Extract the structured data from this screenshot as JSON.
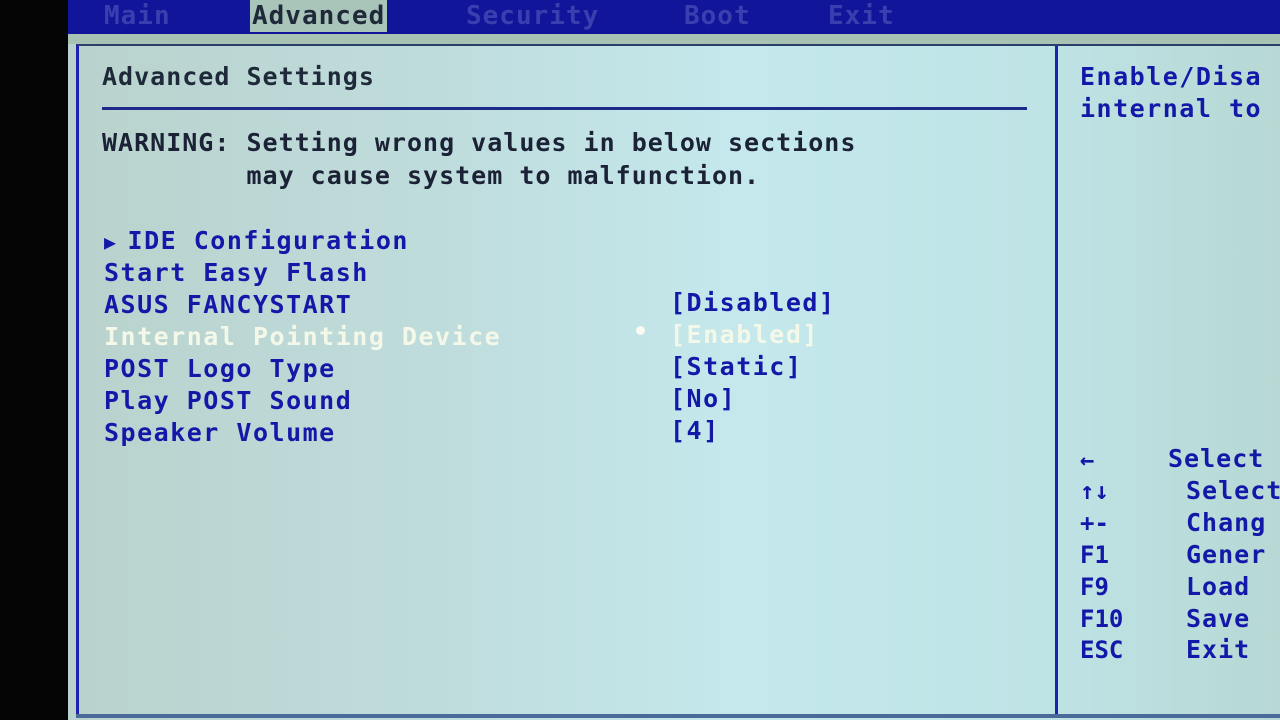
{
  "menubar": {
    "tabs": [
      {
        "label": "Main",
        "active": false
      },
      {
        "label": "Advanced",
        "active": true
      },
      {
        "label": "Security",
        "active": false
      },
      {
        "label": "Boot",
        "active": false
      },
      {
        "label": "Exit",
        "active": false
      }
    ]
  },
  "main": {
    "title": "Advanced Settings",
    "warning_line1": "WARNING: Setting wrong values in below sections",
    "warning_line2": "         may cause system to malfunction.",
    "submenu_arrow": "▶",
    "items": [
      {
        "label": "IDE Configuration",
        "value": null,
        "submenu": true
      },
      {
        "label": "Start Easy Flash",
        "value": null
      },
      {
        "label": "ASUS FANCYSTART",
        "value": "[Disabled]"
      },
      {
        "label": "Internal Pointing Device",
        "value": "[Enabled]",
        "selected": true
      },
      {
        "label": "POST Logo Type",
        "value": "[Static]"
      },
      {
        "label": "Play POST Sound",
        "value": "[No]"
      },
      {
        "label": "Speaker Volume",
        "value": "[4]"
      }
    ]
  },
  "help": {
    "line1": "Enable/Disa",
    "line2": "internal to",
    "keys": [
      {
        "key": "←",
        "desc": "Select"
      },
      {
        "key": "↑↓",
        "desc": "Select"
      },
      {
        "key": "+-",
        "desc": "Chang"
      },
      {
        "key": "F1",
        "desc": "Gener"
      },
      {
        "key": "F9",
        "desc": "Load"
      },
      {
        "key": "F10",
        "desc": "Save"
      },
      {
        "key": "ESC",
        "desc": "Exit"
      }
    ]
  },
  "colors": {
    "menubar_bg": "#10159a",
    "item_text": "#1318a8",
    "selected_text": "#f4f8e8"
  }
}
